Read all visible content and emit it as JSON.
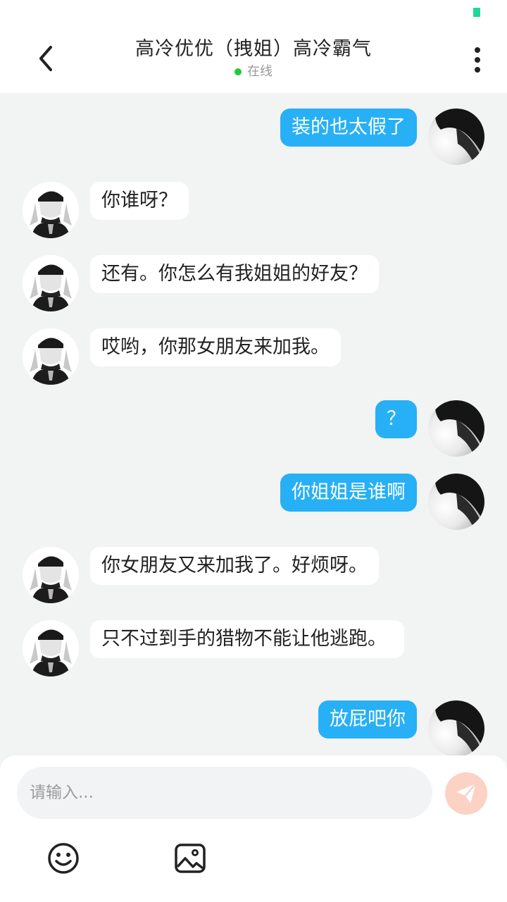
{
  "header": {
    "title": "高冷优优（拽姐）高冷霸气",
    "status": "在线"
  },
  "messages": [
    {
      "side": "right",
      "text": "装的也太假了"
    },
    {
      "side": "left",
      "text": "你谁呀？"
    },
    {
      "side": "left",
      "text": "还有。你怎么有我姐姐的好友？"
    },
    {
      "side": "left",
      "text": "哎哟，你那女朋友来加我。"
    },
    {
      "side": "right",
      "text": "？"
    },
    {
      "side": "right",
      "text": "你姐姐是谁啊"
    },
    {
      "side": "left",
      "text": "你女朋友又来加我了。好烦呀。"
    },
    {
      "side": "left",
      "text": "只不过到手的猎物不能让他逃跑。"
    },
    {
      "side": "right",
      "text": "放屁吧你"
    }
  ],
  "composer": {
    "placeholder": "请输入..."
  },
  "icons": {
    "back": "chevron-left-icon",
    "more": "more-vertical-icon",
    "send": "send-icon",
    "emoji": "smiley-icon",
    "image": "image-icon"
  },
  "colors": {
    "sent_bubble": "#27b0f5",
    "received_bubble": "#ffffff",
    "online_dot": "#1ecb3c",
    "send_button": "#fcd2c4",
    "background": "#f2f3f3"
  }
}
